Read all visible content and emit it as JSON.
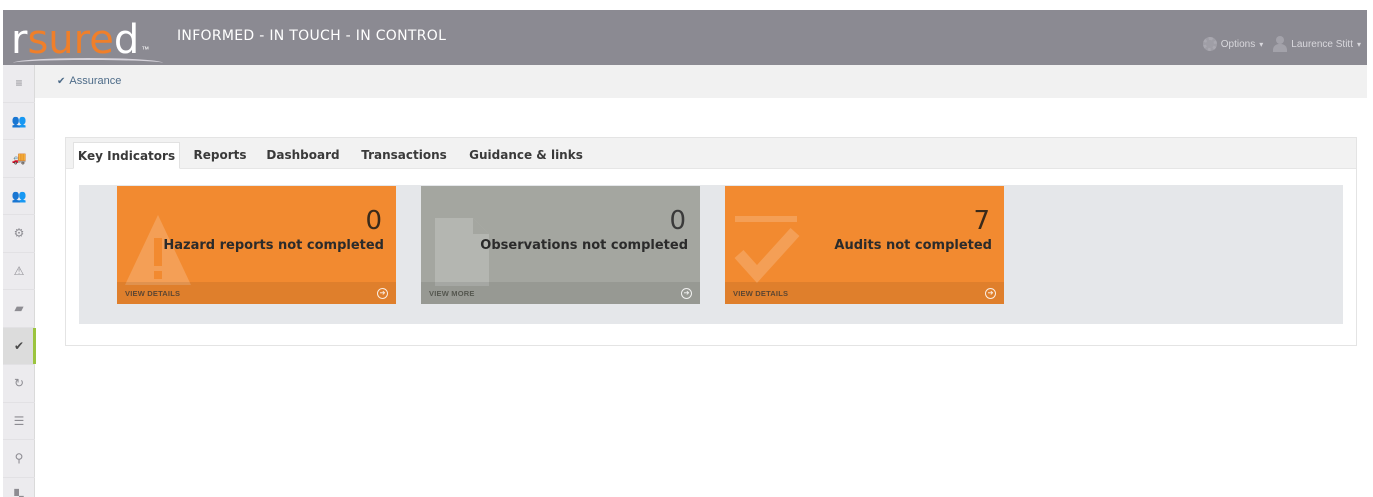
{
  "header": {
    "logo_main": "r",
    "logo_accent": "sure",
    "logo_tail": "d",
    "logo_tm": "™",
    "tagline": "INFORMED - IN TOUCH - IN CONTROL",
    "options_label": "Options",
    "user_label": "Laurence Stitt"
  },
  "sidebar": {
    "items": [
      {
        "icon": "menu-icon",
        "glyph": "≡"
      },
      {
        "icon": "users-icon",
        "glyph": "👥"
      },
      {
        "icon": "vehicle-icon",
        "glyph": "🚚"
      },
      {
        "icon": "group-icon",
        "glyph": "👥"
      },
      {
        "icon": "settings-icon",
        "glyph": "⚙"
      },
      {
        "icon": "hazard-icon",
        "glyph": "⚠"
      },
      {
        "icon": "book-icon",
        "glyph": "▰"
      },
      {
        "icon": "check-icon",
        "glyph": "✔"
      },
      {
        "icon": "refresh-icon",
        "glyph": "↻"
      },
      {
        "icon": "list-icon",
        "glyph": "☰"
      },
      {
        "icon": "location-icon",
        "glyph": "⚲"
      },
      {
        "icon": "library-icon",
        "glyph": "▚"
      }
    ],
    "active_index": 7
  },
  "breadcrumb": {
    "label": "Assurance"
  },
  "tabs": [
    {
      "label": "Key Indicators",
      "active": true
    },
    {
      "label": "Reports",
      "active": false
    },
    {
      "label": "Dashboard",
      "active": false
    },
    {
      "label": "Transactions",
      "active": false
    },
    {
      "label": "Guidance & links",
      "active": false
    }
  ],
  "tiles": [
    {
      "count": "0",
      "label": "Hazard reports not completed",
      "link": "VIEW DETAILS",
      "color": "#f28a30",
      "icon": "hazard-icon"
    },
    {
      "count": "0",
      "label": "Observations not completed",
      "link": "VIEW MORE",
      "color": "#a4a6a0",
      "icon": "document-icon"
    },
    {
      "count": "7",
      "label": "Audits not completed",
      "link": "VIEW DETAILS",
      "color": "#f28a30",
      "icon": "check-icon"
    }
  ],
  "colors": {
    "header_bg": "#8b8a92",
    "accent_orange": "#f28a30",
    "active_marker": "#9bc43e"
  }
}
